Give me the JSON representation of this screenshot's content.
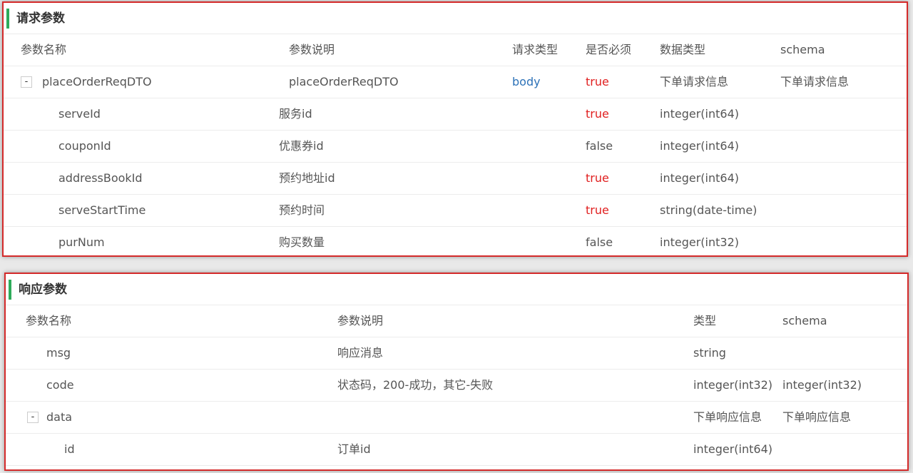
{
  "request": {
    "title": "请求参数",
    "headers": {
      "name": "参数名称",
      "desc": "参数说明",
      "in": "请求类型",
      "required": "是否必须",
      "type": "数据类型",
      "schema": "schema"
    },
    "rows": [
      {
        "name": "placeOrderReqDTO",
        "desc": "placeOrderReqDTO",
        "in": "body",
        "required": "true",
        "type": "下单请求信息",
        "schema": "下单请求信息",
        "expander": "-"
      },
      {
        "name": "serveId",
        "desc": "服务id",
        "in": "",
        "required": "true",
        "type": "integer(int64)",
        "schema": ""
      },
      {
        "name": "couponId",
        "desc": "优惠券id",
        "in": "",
        "required": "false",
        "type": "integer(int64)",
        "schema": ""
      },
      {
        "name": "addressBookId",
        "desc": "预约地址id",
        "in": "",
        "required": "true",
        "type": "integer(int64)",
        "schema": ""
      },
      {
        "name": "serveStartTime",
        "desc": "预约时间",
        "in": "",
        "required": "true",
        "type": "string(date-time)",
        "schema": ""
      },
      {
        "name": "purNum",
        "desc": "购买数量",
        "in": "",
        "required": "false",
        "type": "integer(int32)",
        "schema": ""
      }
    ]
  },
  "response": {
    "title": "响应参数",
    "headers": {
      "name": "参数名称",
      "desc": "参数说明",
      "type": "类型",
      "schema": "schema"
    },
    "rows": [
      {
        "name": "msg",
        "desc": "响应消息",
        "type": "string",
        "schema": ""
      },
      {
        "name": "code",
        "desc": "状态码，200-成功，其它-失败",
        "type": "integer(int32)",
        "schema": "integer(int32)"
      },
      {
        "name": "data",
        "desc": "",
        "type": "下单响应信息",
        "schema": "下单响应信息",
        "expander": "-"
      },
      {
        "name": "id",
        "desc": "订单id",
        "type": "integer(int64)",
        "schema": ""
      }
    ]
  },
  "colors": {
    "required_true": "#e02020",
    "body_type": "#2d72b8",
    "title_bar": "#2eab5a",
    "panel_border": "#d42a2a"
  }
}
